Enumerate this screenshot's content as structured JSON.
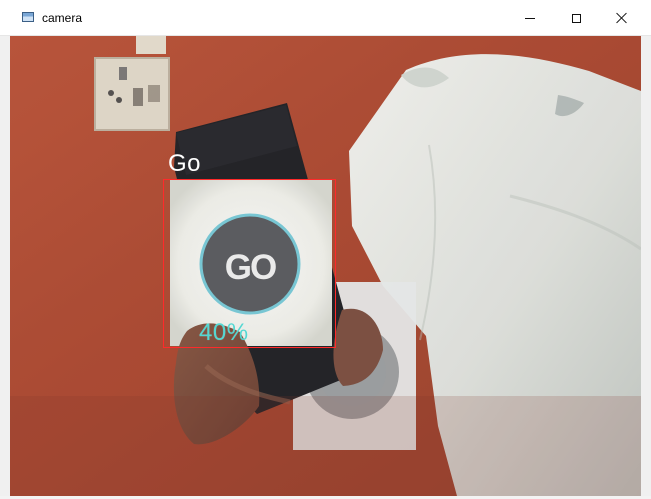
{
  "window": {
    "title": "camera",
    "controls": {
      "minimize_label": "—",
      "maximize_label": "□",
      "close_label": "✕"
    }
  },
  "detection": {
    "label": "Go",
    "confidence": "40%",
    "confidence_value": 0.4
  },
  "icons": {
    "app": "camera-window-icon",
    "minimize": "minimize-icon",
    "maximize": "maximize-icon",
    "close": "close-icon"
  },
  "colors": {
    "detection_box": "#ff2a2a",
    "detection_text": "#ffffff",
    "confidence_text": "#54d7d2"
  }
}
